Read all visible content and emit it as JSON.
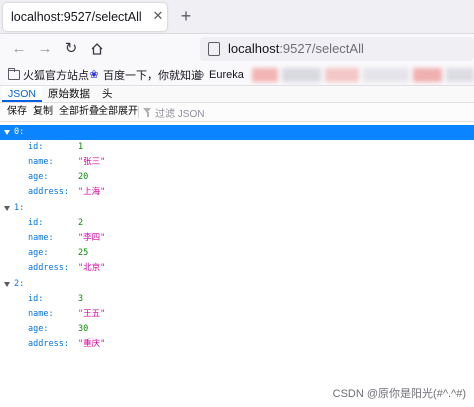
{
  "browser": {
    "tab_title": "localhost:9527/selectAll",
    "tab_close_glyph": "✕",
    "new_tab_glyph": "+",
    "url_host": "localhost",
    "url_path": ":9527/selectAll",
    "nav_icons": [
      "back-icon",
      "forward-icon",
      "reload-icon",
      "home-icon"
    ]
  },
  "bookmarks": [
    {
      "icon": "folder-icon",
      "label": "火狐官方站点"
    },
    {
      "icon": "paw-icon",
      "label": "百度一下，你就知道"
    },
    {
      "icon": "globe-icon",
      "label": "Eureka"
    }
  ],
  "blurred_colors": [
    "#f2b5b5",
    "#d9d9e0",
    "#f4c7c7",
    "#e4e4ea",
    "#f0b0b0",
    "#dcdce3"
  ],
  "viewer": {
    "tabs": [
      "JSON",
      "原始数据",
      "头"
    ],
    "selected_tab": "JSON",
    "toolbar": {
      "save": "保存",
      "copy": "复制",
      "collapse_all": "全部折叠",
      "expand_all": "全部展开",
      "filter_placeholder": "过滤 JSON"
    }
  },
  "json_tree": [
    {
      "index": "0:",
      "id": "1",
      "name": "\"张三\"",
      "age": "20",
      "address": "\"上海\""
    },
    {
      "index": "1:",
      "id": "2",
      "name": "\"李四\"",
      "age": "25",
      "address": "\"北京\""
    },
    {
      "index": "2:",
      "id": "3",
      "name": "\"王五\"",
      "age": "30",
      "address": "\"重庆\""
    }
  ],
  "field_keys": {
    "id": "id:",
    "name": "name:",
    "age": "age:",
    "address": "address:"
  },
  "watermark": "CSDN @原你是阳光(#^.^#)",
  "colors": {
    "accent": "#0060df",
    "selected_row": "#0a84ff",
    "key": "#0074e8",
    "number": "#058b00",
    "string": "#dd00a9"
  }
}
